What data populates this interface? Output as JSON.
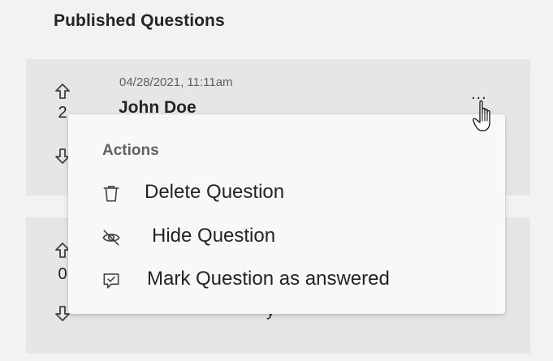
{
  "section": {
    "title": "Published Questions"
  },
  "questions": [
    {
      "timestamp": "04/28/2021, 11:11am",
      "author": "John Doe",
      "votes": "2"
    },
    {
      "votes": "0",
      "text_fragment": "y"
    }
  ],
  "menu": {
    "more_label": "...",
    "header": "Actions",
    "items": [
      {
        "label": "Delete Question",
        "icon": "trash-icon"
      },
      {
        "label": "Hide Question",
        "icon": "eye-off-icon"
      },
      {
        "label": "Mark Question as answered",
        "icon": "chat-check-icon"
      }
    ]
  }
}
